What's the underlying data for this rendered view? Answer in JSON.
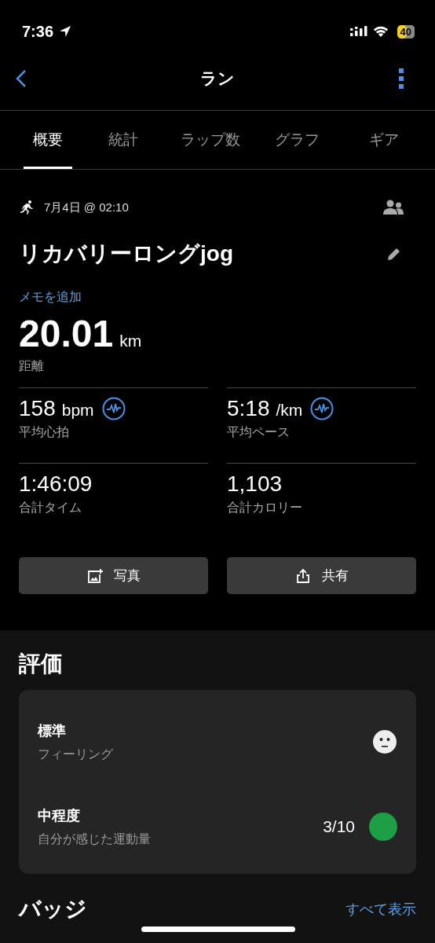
{
  "status_bar": {
    "time": "7:36",
    "battery": "40"
  },
  "nav": {
    "title": "ラン"
  },
  "tabs": [
    {
      "label": "概要",
      "selected": true
    },
    {
      "label": "統計",
      "selected": false
    },
    {
      "label": "ラップ数",
      "selected": false
    },
    {
      "label": "グラフ",
      "selected": false
    },
    {
      "label": "ギア",
      "selected": false
    }
  ],
  "activity": {
    "date": "7月4日 @ 02:10",
    "name": "リカバリーロングjog",
    "add_note": "メモを追加",
    "distance": {
      "value": "20.01",
      "unit": "km",
      "label": "距離"
    }
  },
  "stats": [
    {
      "value": "158",
      "unit": "bpm",
      "label": "平均心拍",
      "chart_icon": true
    },
    {
      "value": "5:18",
      "unit": "/km",
      "label": "平均ペース",
      "chart_icon": true
    },
    {
      "value": "1:46:09",
      "label": "合計タイム",
      "chart_icon": false
    },
    {
      "value": "1,103",
      "label": "合計カロリー",
      "chart_icon": false
    }
  ],
  "actions": [
    {
      "kind": "photo",
      "label": "写真"
    },
    {
      "kind": "share",
      "label": "共有"
    }
  ],
  "evaluation": {
    "title": "評価",
    "items": [
      {
        "kind": "feeling",
        "value": "標準",
        "label": "フィーリング"
      },
      {
        "kind": "effort",
        "value": "中程度",
        "label": "自分が感じた運動量",
        "score": "3/10",
        "color": "#1e9e45"
      }
    ]
  },
  "badges": {
    "title": "バッジ",
    "link": "すべて表示"
  }
}
